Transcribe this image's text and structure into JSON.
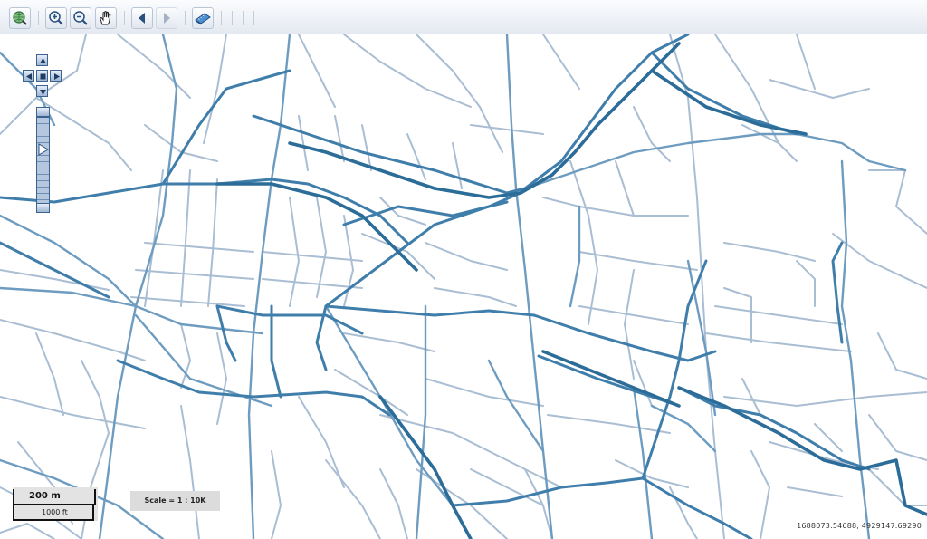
{
  "toolbar": {
    "buttons": [
      {
        "name": "zoom-to-extent-button",
        "icon": "globe-magnifier-icon"
      },
      {
        "name": "zoom-in-button",
        "icon": "zoom-in-icon"
      },
      {
        "name": "zoom-out-button",
        "icon": "zoom-out-icon"
      },
      {
        "name": "pan-button",
        "icon": "hand-icon"
      },
      {
        "name": "previous-extent-button",
        "icon": "triangle-left-icon"
      },
      {
        "name": "next-extent-button",
        "icon": "triangle-right-icon"
      },
      {
        "name": "measure-button",
        "icon": "ruler-icon"
      }
    ]
  },
  "navigation": {
    "pan_buttons": [
      "pan-up",
      "pan-left",
      "pan-center",
      "pan-right",
      "pan-down"
    ],
    "zoom_level_fraction": 0.35
  },
  "scale_bar": {
    "metric_label": "200 m",
    "imperial_label": "1000 ft"
  },
  "scale_text": "Scale = 1 : 10K",
  "coordinates": "1688073.54688, 4929147.69290",
  "colors": {
    "minor_road": "#9db3cc",
    "major_road": "#4e86ad",
    "arterial_road": "#2b6c98",
    "toolbar_accent": "#3b6ea5"
  }
}
